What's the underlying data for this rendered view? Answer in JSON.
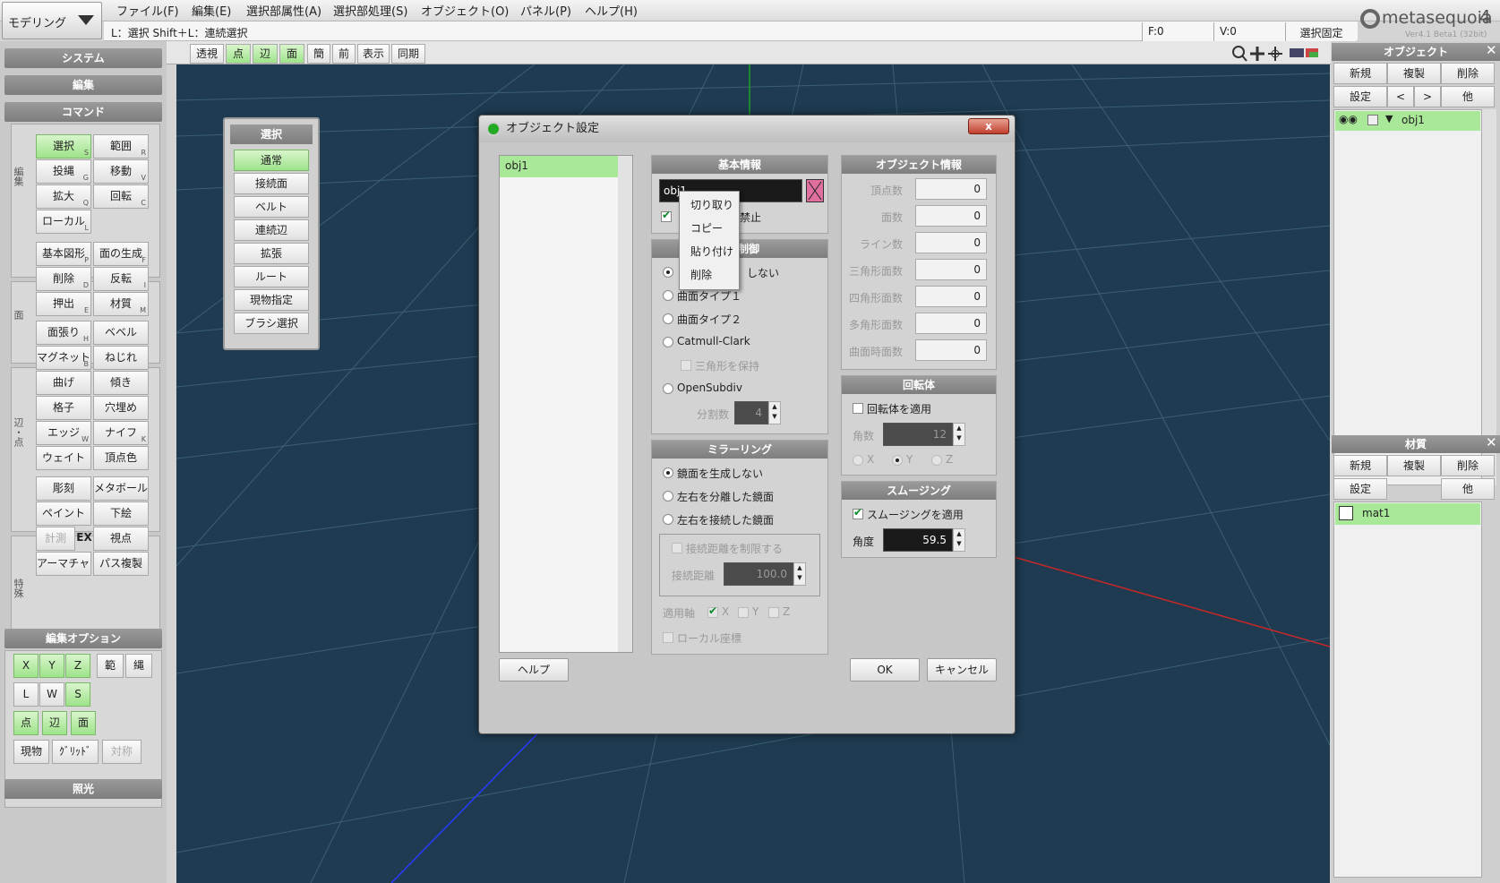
{
  "mode": "モデリング",
  "menus": [
    "ファイル(F)",
    "編集(E)",
    "選択部属性(A)",
    "選択部処理(S)",
    "オブジェクト(O)",
    "パネル(P)",
    "ヘルプ(H)"
  ],
  "status": {
    "hint": "L：選択  Shift＋L：連続選択",
    "faces": "F:0",
    "verts": "V:0",
    "lock": "選択固定"
  },
  "logo": {
    "name": "metasequoia",
    "num": "4",
    "version": "Ver4.1 Beta1 (32bit)"
  },
  "left": {
    "system": "システム",
    "edit": "編集",
    "command": "コマンド",
    "group_edit": "編集",
    "group_face": "面",
    "group_edge": "辺・点",
    "group_special": "特殊",
    "cmds": [
      {
        "label": "選択",
        "key": "S"
      },
      {
        "label": "範囲",
        "key": "R"
      },
      {
        "label": "投縄",
        "key": "G"
      },
      {
        "label": "移動",
        "key": "V"
      },
      {
        "label": "拡大",
        "key": "Q"
      },
      {
        "label": "回転",
        "key": "C"
      },
      {
        "label": "ローカル",
        "key": "L"
      },
      {
        "label": "基本図形",
        "key": "P"
      },
      {
        "label": "面の生成",
        "key": "F"
      },
      {
        "label": "削除",
        "key": "D"
      },
      {
        "label": "反転",
        "key": "I"
      },
      {
        "label": "押出",
        "key": "E"
      },
      {
        "label": "材質",
        "key": "M"
      },
      {
        "label": "面張り",
        "key": "H"
      },
      {
        "label": "ベベル",
        "key": ""
      },
      {
        "label": "マグネット",
        "key": "B"
      },
      {
        "label": "ねじれ",
        "key": ""
      },
      {
        "label": "曲げ",
        "key": ""
      },
      {
        "label": "傾き",
        "key": ""
      },
      {
        "label": "格子",
        "key": ""
      },
      {
        "label": "穴埋め",
        "key": ""
      },
      {
        "label": "エッジ",
        "key": "W"
      },
      {
        "label": "ナイフ",
        "key": "K"
      },
      {
        "label": "ウェイト",
        "key": ""
      },
      {
        "label": "頂点色",
        "key": ""
      },
      {
        "label": "彫刻",
        "key": ""
      },
      {
        "label": "メタボール",
        "key": ""
      },
      {
        "label": "ペイント",
        "key": ""
      },
      {
        "label": "下絵",
        "key": ""
      },
      {
        "label": "計測",
        "key": ""
      },
      {
        "label": "EX",
        "key": ""
      },
      {
        "label": "視点",
        "key": ""
      },
      {
        "label": "アーマチャー",
        "key": ""
      },
      {
        "label": "パス複製",
        "key": ""
      }
    ],
    "editopt": "編集オプション",
    "opt": {
      "x": "X",
      "y": "Y",
      "z": "Z",
      "range": "範",
      "rope": "縄",
      "l": "L",
      "w": "W",
      "s": "S",
      "pt": "点",
      "edge": "辺",
      "face": "面",
      "cur": "現物",
      "grid": "ｸﾞﾘｯﾄﾞ",
      "sym": "対称"
    },
    "light": "照光"
  },
  "viewtb": [
    "透視",
    "点",
    "辺",
    "面",
    "簡",
    "前",
    "表示",
    "同期"
  ],
  "selpanel": {
    "title": "選択",
    "items": [
      "通常",
      "接続面",
      "ベルト",
      "連続辺",
      "拡張",
      "ルート",
      "現物指定",
      "ブラシ選択"
    ]
  },
  "right": {
    "objhdr": "オブジェクト",
    "new": "新規",
    "dup": "複製",
    "del": "削除",
    "set": "設定",
    "prev": "<",
    "next": ">",
    "other": "他",
    "obj1": "obj1",
    "mathdr": "材質",
    "mat1": "mat1"
  },
  "dialog": {
    "title": "オブジェクト設定",
    "close": "x",
    "list_item": "obj1",
    "basic": {
      "header": "基本情報",
      "name": "obj1",
      "lockedit": "禁止"
    },
    "ctx": [
      "切り取り",
      "コピー",
      "貼り付け",
      "削除"
    ],
    "curve": {
      "header": "制御",
      "opt0": "しない",
      "opt1": "曲面タイプ１",
      "opt2": "曲面タイプ２",
      "opt3": "Catmull-Clark",
      "keeptri": "三角形を保持",
      "opt4": "OpenSubdiv",
      "div_label": "分割数",
      "div": "4"
    },
    "mirror": {
      "header": "ミラーリング",
      "opt0": "鏡面を生成しない",
      "opt1": "左右を分離した鏡面",
      "opt2": "左右を接続した鏡面",
      "limit": "接続距離を制限する",
      "dist_label": "接続距離",
      "dist": "100.0",
      "axis_label": "適用軸",
      "ax": "X",
      "ay": "Y",
      "az": "Z",
      "local": "ローカル座標"
    },
    "info": {
      "header": "オブジェクト情報",
      "rows": [
        {
          "label": "頂点数",
          "value": "0"
        },
        {
          "label": "面数",
          "value": "0"
        },
        {
          "label": "ライン数",
          "value": "0"
        },
        {
          "label": "三角形面数",
          "value": "0"
        },
        {
          "label": "四角形面数",
          "value": "0"
        },
        {
          "label": "多角形面数",
          "value": "0"
        },
        {
          "label": "曲面時面数",
          "value": "0"
        }
      ]
    },
    "lathe": {
      "header": "回転体",
      "apply": "回転体を適用",
      "count_label": "角数",
      "count": "12",
      "x": "X",
      "y": "Y",
      "z": "Z"
    },
    "smooth": {
      "header": "スムージング",
      "apply": "スムージングを適用",
      "angle_label": "角度",
      "angle": "59.5"
    },
    "help": "ヘルプ",
    "ok": "OK",
    "cancel": "キャンセル"
  }
}
